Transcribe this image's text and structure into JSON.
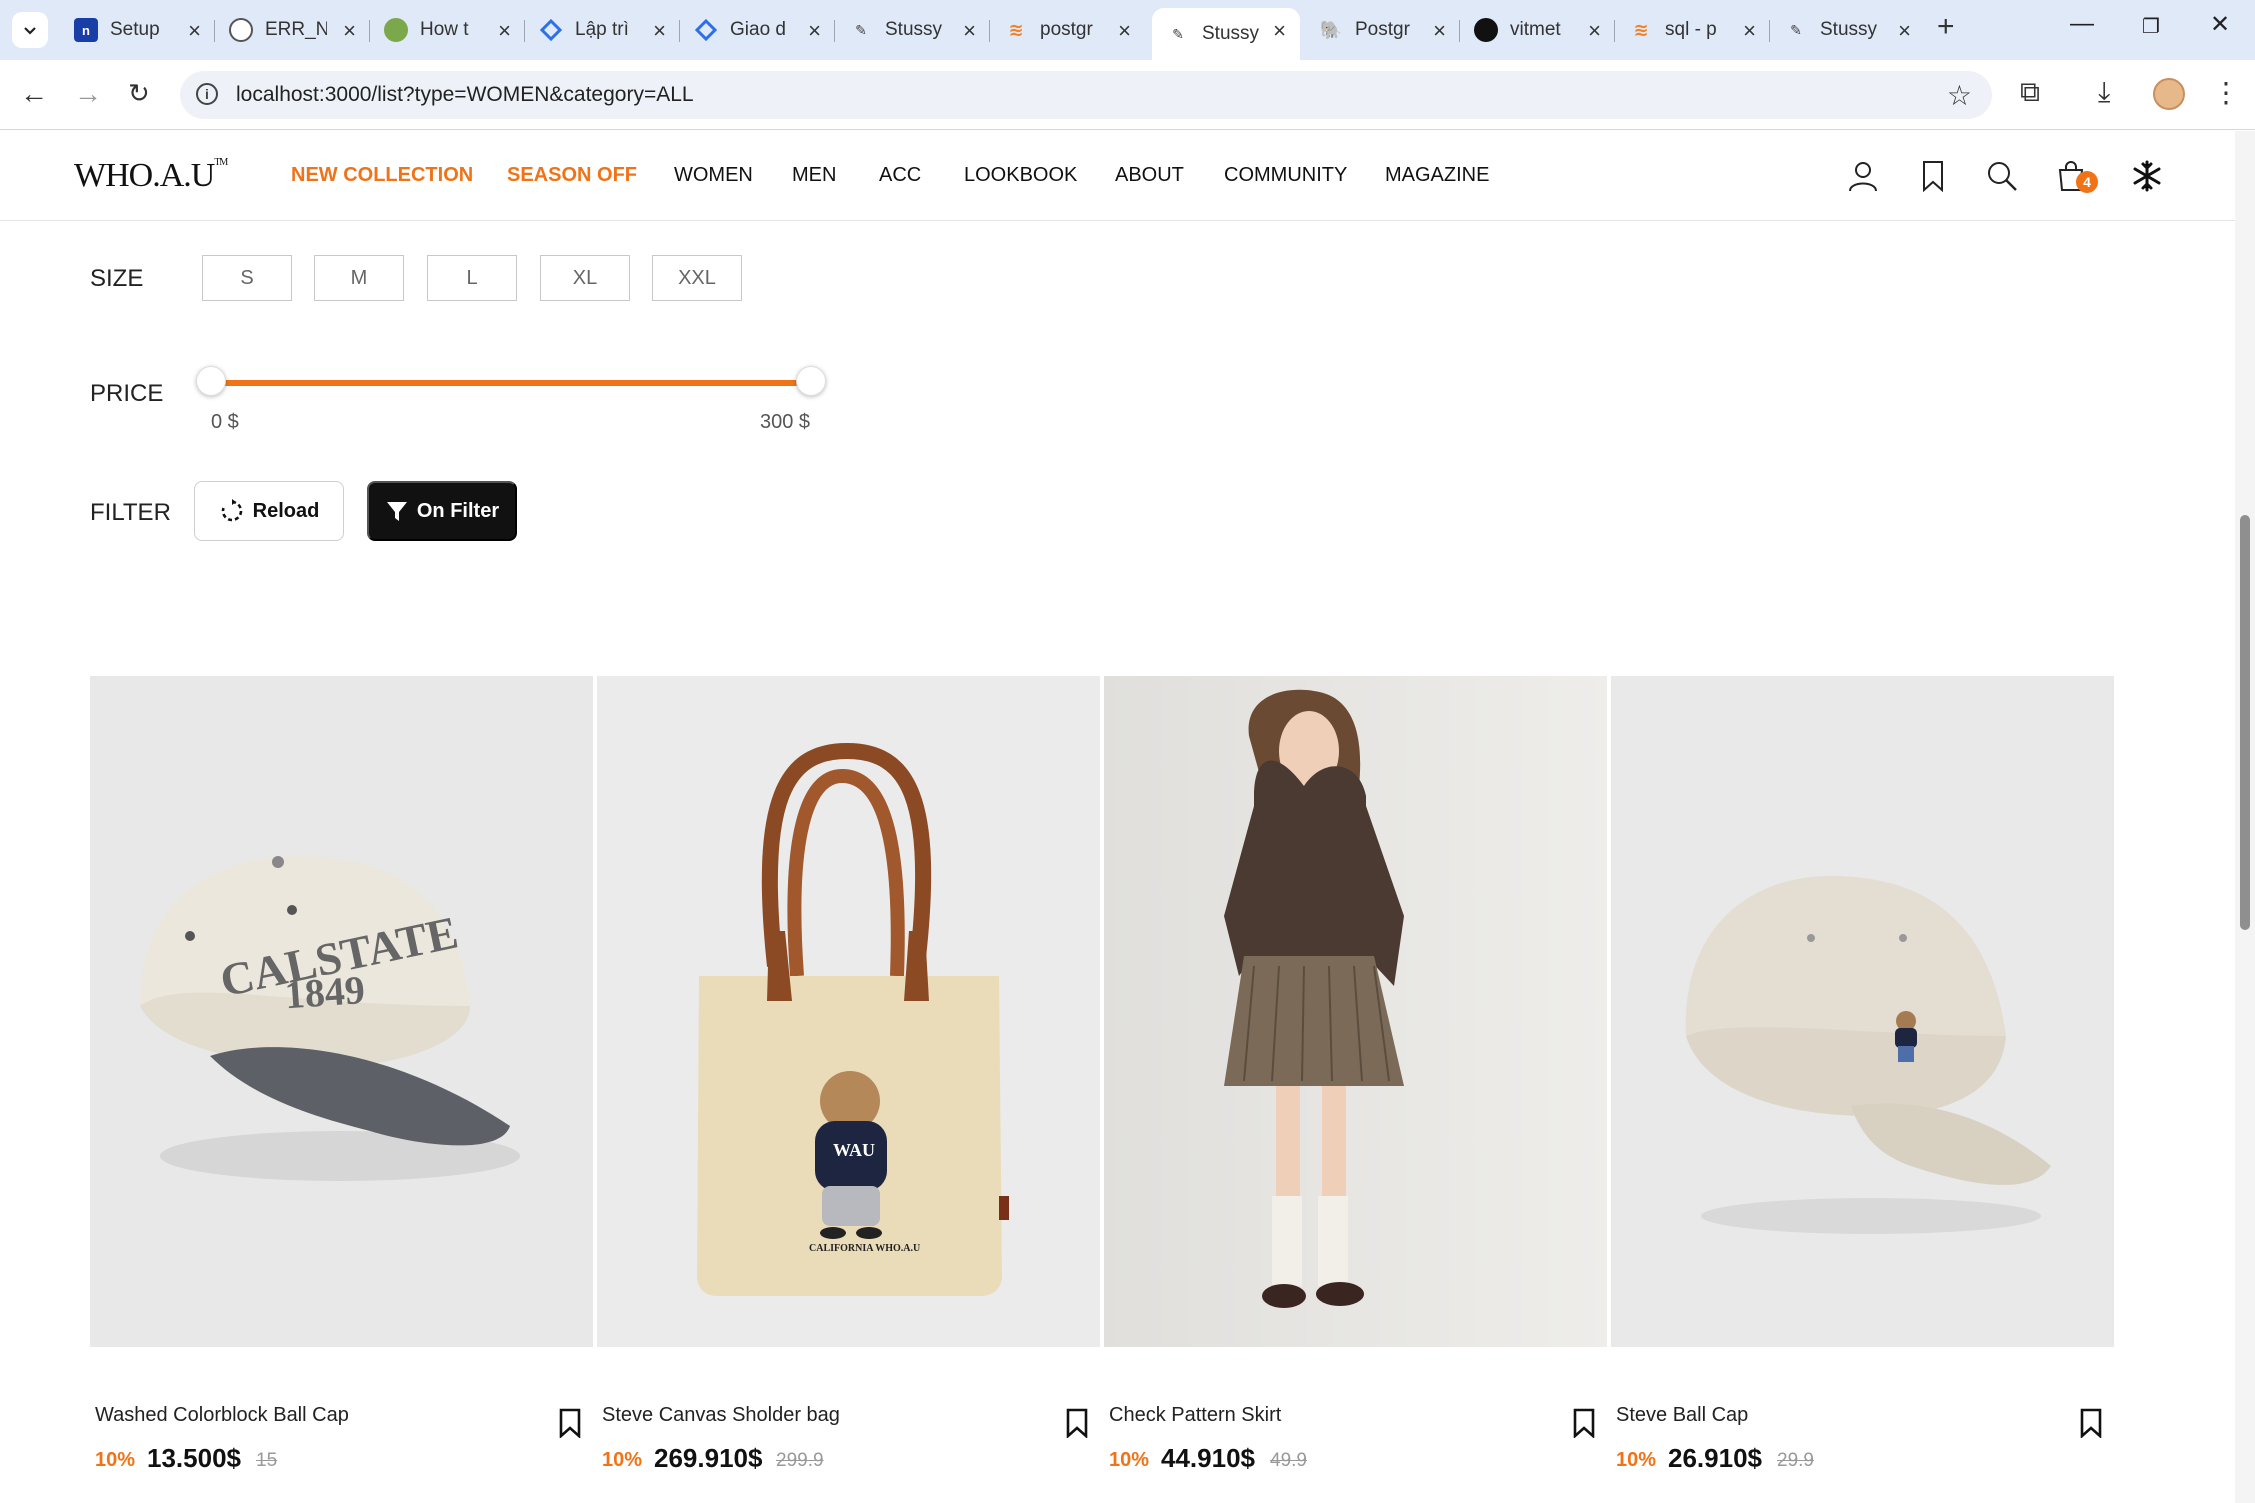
{
  "browser": {
    "tabs": [
      {
        "label": "Setup",
        "favicon": "n-icon",
        "color": "#1a3ea8"
      },
      {
        "label": "ERR_N",
        "favicon": "globe-icon",
        "color": "#555555"
      },
      {
        "label": "How t",
        "favicon": "leaf-icon",
        "color": "#7aa84a"
      },
      {
        "label": "Lập trì",
        "favicon": "diamond-icon",
        "color": "#2c6fe6"
      },
      {
        "label": "Giao d",
        "favicon": "diamond-icon",
        "color": "#2c6fe6"
      },
      {
        "label": "Stussy",
        "favicon": "stussy-icon",
        "color": "#444444"
      },
      {
        "label": "postgr",
        "favicon": "stackoverflow-icon",
        "color": "#f48024"
      },
      {
        "label": "Stussy",
        "favicon": "stussy-icon",
        "color": "#444444"
      },
      {
        "label": "Postgr",
        "favicon": "elephant-icon",
        "color": "#336791"
      },
      {
        "label": "vitmet",
        "favicon": "github-icon",
        "color": "#111111"
      },
      {
        "label": "sql - p",
        "favicon": "stackoverflow-icon",
        "color": "#f48024"
      },
      {
        "label": "Stussy",
        "favicon": "stussy-icon",
        "color": "#444444"
      }
    ],
    "active_tab": 7,
    "url": "localhost:3000/list?type=WOMEN&category=ALL"
  },
  "header": {
    "logo": "WHO.A.U",
    "logo_tm": "TM",
    "nav": [
      "NEW COLLECTION",
      "SEASON OFF",
      "WOMEN",
      "MEN",
      "ACC",
      "LOOKBOOK",
      "ABOUT",
      "COMMUNITY",
      "MAGAZINE"
    ],
    "cart_count": "4",
    "accent": "#f07317"
  },
  "filters": {
    "size_label": "SIZE",
    "sizes": [
      "S",
      "M",
      "L",
      "XL",
      "XXL"
    ],
    "price_label": "PRICE",
    "price_min": "0 $",
    "price_max": "300 $",
    "price_range_selected": [
      0,
      300
    ],
    "filter_label": "FILTER",
    "reload_label": "Reload",
    "on_filter_label": "On Filter"
  },
  "products": [
    {
      "name": "Washed Colorblock Ball Cap",
      "discount": "10%",
      "price": "13.500$",
      "original": "15",
      "image": "cap-calstate-image"
    },
    {
      "name": "Steve Canvas Sholder bag",
      "discount": "10%",
      "price": "269.910$",
      "original": "299.9",
      "image": "tote-bag-image"
    },
    {
      "name": "Check Pattern Skirt",
      "discount": "10%",
      "price": "44.910$",
      "original": "49.9",
      "image": "model-skirt-image"
    },
    {
      "name": "Steve Ball Cap",
      "discount": "10%",
      "price": "26.910$",
      "original": "29.9",
      "image": "cap-bear-image"
    }
  ],
  "product_images": {
    "cap1_text_line1": "CALSTATE",
    "cap1_text_line2": "1849",
    "bag_text_sweater": "WAU",
    "bag_text_caption": "CALIFORNIA WHO.A.U"
  }
}
